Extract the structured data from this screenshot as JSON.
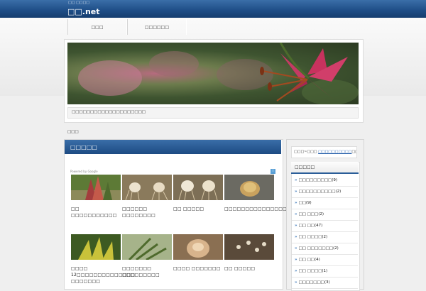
{
  "site": {
    "tagline": "□□ □□□□",
    "title": "□□.net"
  },
  "nav": {
    "items": [
      "□□□",
      "□□□□□□"
    ]
  },
  "hero": {
    "caption": "□□□□□□□□□□□□□□□□□□□□"
  },
  "breadcrumb": "□□□",
  "main": {
    "heading": "□□□□□",
    "powered_by": "Powered by Google",
    "ad_icon": "i",
    "cards": [
      {
        "title": "□□ □□□□□□□□□□□"
      },
      {
        "title": "□□□□□□ □□□□□□□□"
      },
      {
        "title": "□□ □□□□□"
      },
      {
        "title": "□□□□□□□□□□□□□□□□"
      },
      {
        "title": "□□□□ 12□□□□□□□□□□□□□□ □□□□□□□"
      },
      {
        "title": "□□□□□□□ □□□□□□□□□"
      },
      {
        "title": "□□□□ □□□□□□□"
      },
      {
        "title": "□□ □□□□□"
      }
    ]
  },
  "sidebar": {
    "search_before": "□□□~□□□ ",
    "search_link": "□□□□□□□□□□",
    "search_after": "□□□□□□□□□□",
    "categories_title": "□□□□□",
    "categories": [
      {
        "label": "□□□□□□□□□",
        "count": "(9)"
      },
      {
        "label": "□□□□□□□□□□",
        "count": "(2)"
      },
      {
        "label": "□□",
        "count": "(9)"
      },
      {
        "label": "□□ □□□",
        "count": "(2)"
      },
      {
        "label": "□□ □□",
        "count": "(47)"
      },
      {
        "label": "□□ □□□□",
        "count": "(2)"
      },
      {
        "label": "□□ □□□□□□□",
        "count": "(2)"
      },
      {
        "label": "□□ □□",
        "count": "(4)"
      },
      {
        "label": "□□ □□□□",
        "count": "(1)"
      },
      {
        "label": "□□□□□□□",
        "count": "(3)"
      }
    ]
  },
  "colors": {
    "header_blue": "#1e4d86",
    "link_blue": "#1e5aa8"
  }
}
